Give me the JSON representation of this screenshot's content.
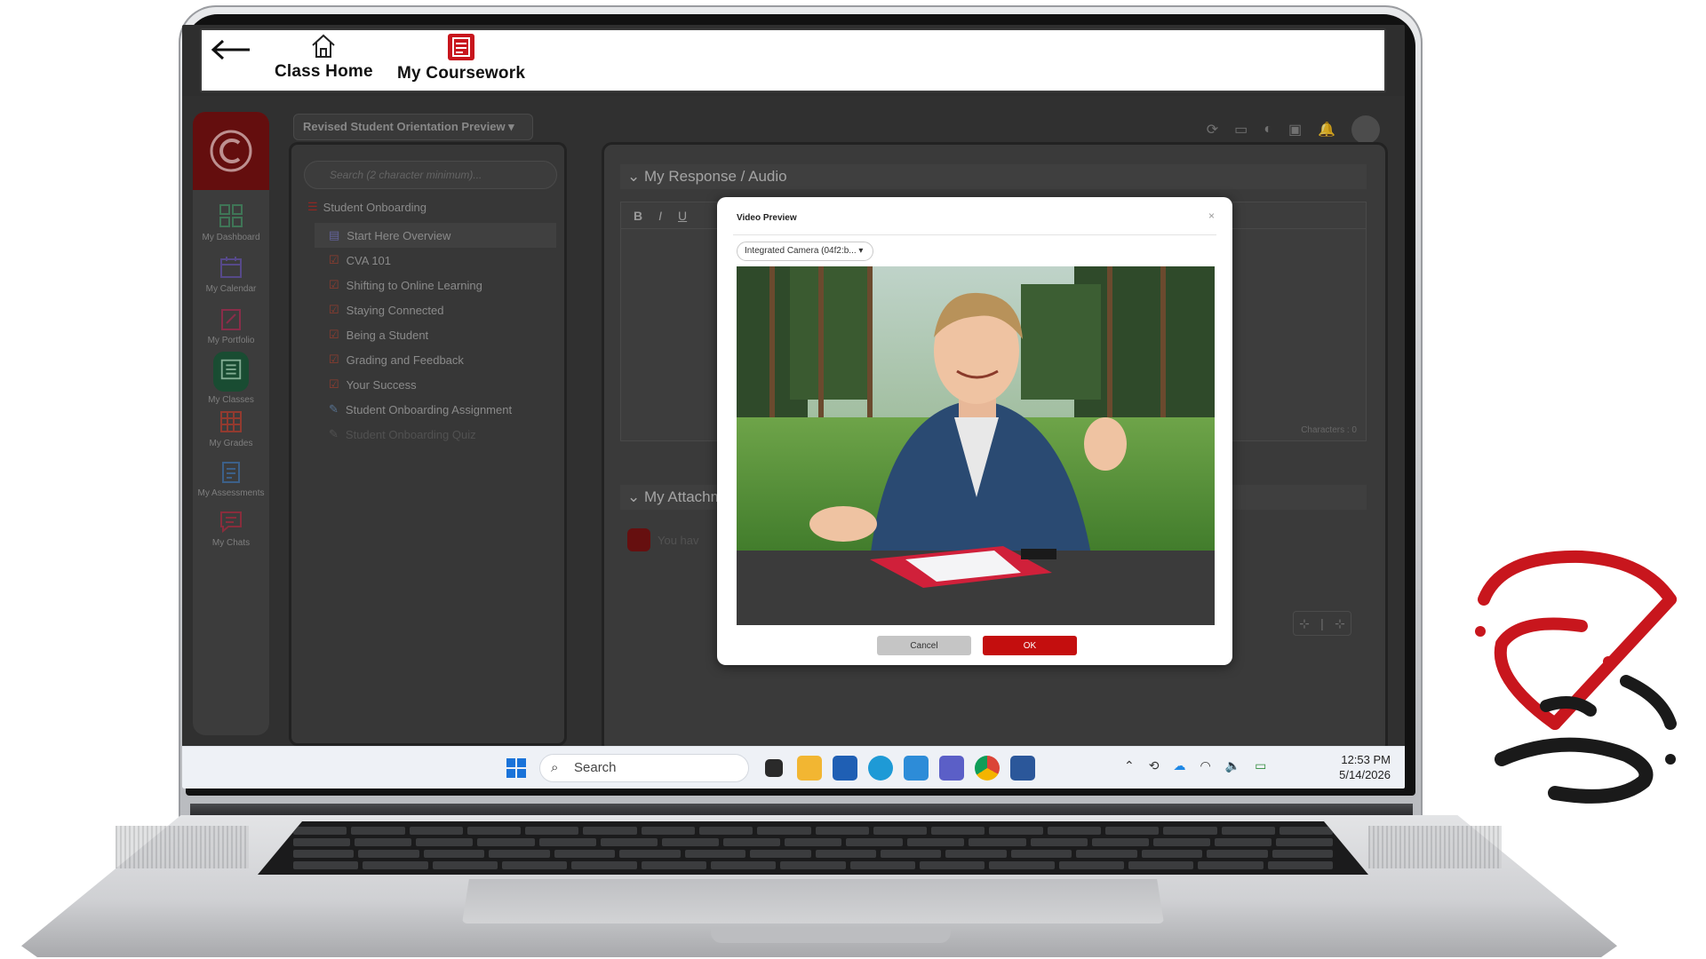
{
  "topnav": {
    "items": [
      {
        "label": "Class Home",
        "icon": "home-icon"
      },
      {
        "label": "My Coursework",
        "icon": "coursework-icon"
      }
    ]
  },
  "app": {
    "course_selector": "Revised Student Orientation Preview",
    "search_placeholder": "Search (2 character minimum)...",
    "rail": [
      {
        "label": "My Dashboard",
        "icon": "dashboard-icon"
      },
      {
        "label": "My Calendar",
        "icon": "calendar-icon"
      },
      {
        "label": "My Portfolio",
        "icon": "portfolio-icon"
      },
      {
        "label": "My Classes",
        "icon": "classes-icon",
        "active": true
      },
      {
        "label": "My Grades",
        "icon": "grades-icon"
      },
      {
        "label": "My Assessments",
        "icon": "assessments-icon"
      },
      {
        "label": "My Chats",
        "icon": "chats-icon"
      }
    ],
    "tree": {
      "root": "Student Onboarding",
      "items": [
        {
          "label": "Start Here Overview"
        },
        {
          "label": "CVA 101"
        },
        {
          "label": "Shifting to Online Learning"
        },
        {
          "label": "Staying Connected"
        },
        {
          "label": "Being a Student"
        },
        {
          "label": "Grading and Feedback"
        },
        {
          "label": "Your Success"
        },
        {
          "label": "Student Onboarding Assignment"
        },
        {
          "label": "Student Onboarding Quiz"
        }
      ]
    },
    "response_header": "My Response / Audio",
    "editor_tools": [
      "B",
      "I",
      "U"
    ],
    "characters": "Characters : 0",
    "attachments_header": "My Attachm",
    "attachments_text": "You hav"
  },
  "modal": {
    "title": "Video Preview",
    "close": "×",
    "camera": "Integrated Camera (04f2:b...",
    "cancel": "Cancel",
    "ok": "OK"
  },
  "taskbar": {
    "search": "Search",
    "time": "12:53 PM",
    "date": "5/14/2026"
  },
  "colors": {
    "brand_red": "#c8161d",
    "dark_red": "#7b0f0f",
    "accent_green": "#1f5d3d"
  }
}
